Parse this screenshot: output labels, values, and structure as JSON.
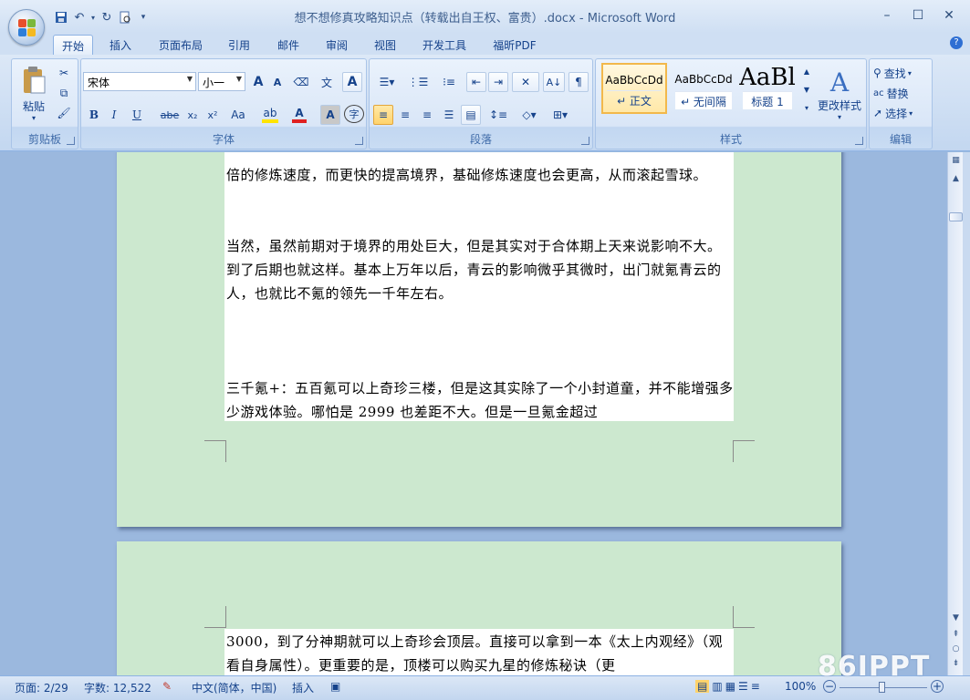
{
  "window": {
    "title": "想不想修真攻略知识点（转载出自王权、富贵）.docx - Microsoft Word",
    "minimize": "–",
    "maximize": "☐",
    "close": "✕"
  },
  "tabs": [
    "开始",
    "插入",
    "页面布局",
    "引用",
    "邮件",
    "审阅",
    "视图",
    "开发工具",
    "福昕PDF"
  ],
  "ribbon": {
    "clipboard": {
      "label": "剪贴板",
      "paste": "粘贴"
    },
    "font": {
      "label": "字体",
      "font_name": "宋体",
      "font_size": "小一",
      "bold": "B",
      "italic": "I",
      "underline": "U",
      "strike": "abe",
      "subscript": "x₂",
      "superscript": "x²",
      "change_case": "Aa",
      "grow": "A",
      "shrink": "A",
      "char_border": "A",
      "char_shade": "A",
      "encircle": "字"
    },
    "paragraph": {
      "label": "段落"
    },
    "styles": {
      "label": "样式",
      "items": [
        {
          "sample": "AaBbCcDd",
          "name": "↵ 正文"
        },
        {
          "sample": "AaBbCcDd",
          "name": "↵ 无间隔"
        },
        {
          "sample": "AaBl",
          "name": "标题 1"
        }
      ],
      "change_styles": "更改样式"
    },
    "editing": {
      "label": "编辑",
      "find": "查找",
      "replace": "替换",
      "select": "选择"
    }
  },
  "document": {
    "page1_paragraphs": [
      "倍的修炼速度，而更快的提高境界，基础修炼速度也会更高，从而滚起雪球。",
      "当然，虽然前期对于境界的用处巨大，但是其实对于合体期上天来说影响不大。到了后期也就这样。基本上万年以后，青云的影响微乎其微时，出门就氪青云的人，也就比不氪的领先一千年左右。",
      "三千氪+：五百氪可以上奇珍三楼，但是这其实除了一个小封道童，并不能增强多少游戏体验。哪怕是 2999 也差距不大。但是一旦氪金超过"
    ],
    "page2_paragraphs": [
      "3000，到了分神期就可以上奇珍会顶层。直接可以拿到一本《太上内观经》（观看自身属性）。更重要的是，顶楼可以购买九星的修炼秘诀（更"
    ]
  },
  "statusbar": {
    "page": "页面: 2/29",
    "words": "字数: 12,522",
    "language": "中文(简体，中国)",
    "mode": "插入",
    "zoom": "100%"
  },
  "watermark": "86IPPT"
}
